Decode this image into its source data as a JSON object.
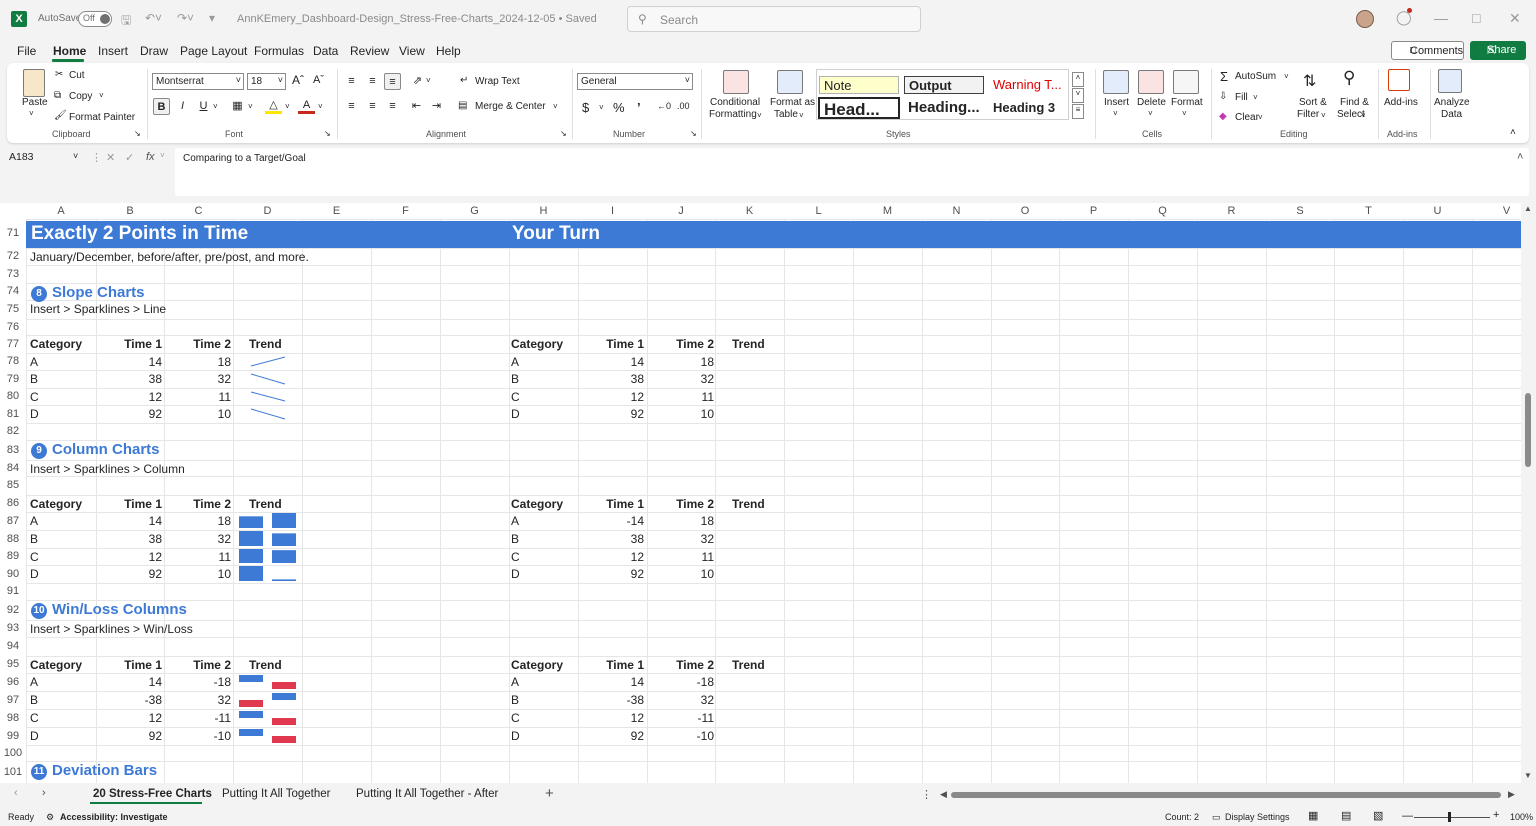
{
  "window": {
    "app_icon": "X",
    "autosave_label": "AutoSave",
    "autosave_state": "Off",
    "doc_title": "AnnKEmery_Dashboard-Design_Stress-Free-Charts_2024-12-05 • Saved",
    "search_placeholder": "Search"
  },
  "menu": [
    "File",
    "Home",
    "Insert",
    "Draw",
    "Page Layout",
    "Formulas",
    "Data",
    "Review",
    "View",
    "Help"
  ],
  "actions": {
    "comments": "Comments",
    "share": "Share"
  },
  "ribbon": {
    "clipboard": {
      "paste": "Paste",
      "cut": "Cut",
      "copy": "Copy",
      "format_painter": "Format Painter",
      "label": "Clipboard"
    },
    "font": {
      "name": "Montserrat",
      "size": "18",
      "label": "Font"
    },
    "alignment": {
      "wrap": "Wrap Text",
      "merge": "Merge & Center",
      "label": "Alignment"
    },
    "number": {
      "format": "General",
      "label": "Number"
    },
    "styles": {
      "conditional": "Conditional",
      "formatting": "Formatting",
      "format_as": "Format as",
      "table": "Table",
      "note": "Note",
      "output": "Output",
      "warning": "Warning T...",
      "head": "Head...",
      "heading": "Heading...",
      "heading3": "Heading 3",
      "label": "Styles"
    },
    "cells": {
      "insert": "Insert",
      "delete": "Delete",
      "format": "Format",
      "label": "Cells"
    },
    "editing": {
      "autosum": "AutoSum",
      "fill": "Fill",
      "clear": "Clear",
      "sort": "Sort &",
      "filter": "Filter",
      "find": "Find &",
      "select": "Select",
      "label": "Editing"
    },
    "addins": {
      "addins": "Add-ins",
      "label": "Add-ins",
      "analyze": "Analyze",
      "data": "Data"
    }
  },
  "formula": {
    "cell_ref": "A183",
    "content": "Comparing to a Target/Goal"
  },
  "columns": [
    "A",
    "B",
    "C",
    "D",
    "E",
    "F",
    "G",
    "H",
    "I",
    "J",
    "K",
    "L",
    "M",
    "N",
    "O",
    "P",
    "Q",
    "R",
    "S",
    "T",
    "U",
    "V"
  ],
  "rows": [
    "71",
    "72",
    "73",
    "74",
    "75",
    "76",
    "77",
    "78",
    "79",
    "80",
    "81",
    "82",
    "83",
    "84",
    "85",
    "86",
    "87",
    "88",
    "89",
    "90",
    "91",
    "92",
    "93",
    "94",
    "95",
    "96",
    "97",
    "98",
    "99",
    "100",
    "101"
  ],
  "sheet": {
    "banner_left": "Exactly 2 Points in Time",
    "banner_right": "Your Turn",
    "intro": "January/December, before/after, pre/post, and more.",
    "headers": {
      "category": "Category",
      "time1": "Time 1",
      "time2": "Time 2",
      "trend": "Trend"
    },
    "sections": [
      {
        "badge": "8",
        "title": "Slope Charts",
        "instruction": "Insert > Sparklines > Line",
        "left": [
          [
            "A",
            "14",
            "18"
          ],
          [
            "B",
            "38",
            "32"
          ],
          [
            "C",
            "12",
            "11"
          ],
          [
            "D",
            "92",
            "10"
          ]
        ],
        "right": [
          [
            "A",
            "14",
            "18"
          ],
          [
            "B",
            "38",
            "32"
          ],
          [
            "C",
            "12",
            "11"
          ],
          [
            "D",
            "92",
            "10"
          ]
        ]
      },
      {
        "badge": "9",
        "title": "Column Charts",
        "instruction": "Insert > Sparklines > Column",
        "left": [
          [
            "A",
            "14",
            "18"
          ],
          [
            "B",
            "38",
            "32"
          ],
          [
            "C",
            "12",
            "11"
          ],
          [
            "D",
            "92",
            "10"
          ]
        ],
        "right": [
          [
            "A",
            "-14",
            "18"
          ],
          [
            "B",
            "38",
            "32"
          ],
          [
            "C",
            "12",
            "11"
          ],
          [
            "D",
            "92",
            "10"
          ]
        ]
      },
      {
        "badge": "10",
        "title": "Win/Loss Columns",
        "instruction": "Insert > Sparklines > Win/Loss",
        "left": [
          [
            "A",
            "14",
            "-18"
          ],
          [
            "B",
            "-38",
            "32"
          ],
          [
            "C",
            "12",
            "-11"
          ],
          [
            "D",
            "92",
            "-10"
          ]
        ],
        "right": [
          [
            "A",
            "14",
            "-18"
          ],
          [
            "B",
            "-38",
            "32"
          ],
          [
            "C",
            "12",
            "-11"
          ],
          [
            "D",
            "92",
            "-10"
          ]
        ]
      }
    ],
    "next_section": {
      "badge": "11",
      "title": "Deviation Bars"
    }
  },
  "tabs": [
    "20 Stress-Free Charts",
    "Putting It All Together",
    "Putting It All Together - After"
  ],
  "status": {
    "ready": "Ready",
    "accessibility": "Accessibility: Investigate",
    "count": "Count: 2",
    "display": "Display Settings",
    "zoom": "100%"
  },
  "colors": {
    "accent": "#3d7ad6",
    "excel_green": "#107c41",
    "loss_red": "#e0384f"
  }
}
